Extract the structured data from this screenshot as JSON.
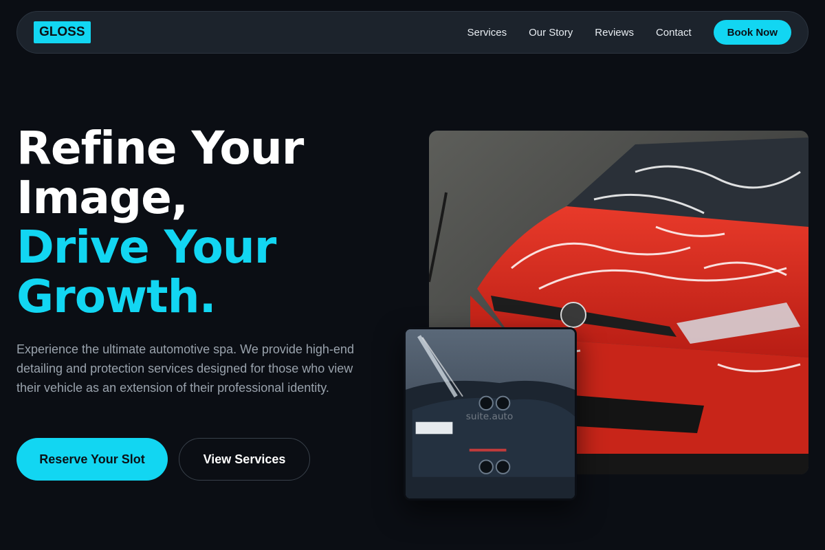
{
  "nav": {
    "logo": "GLOSS",
    "links": [
      "Services",
      "Our Story",
      "Reviews",
      "Contact"
    ],
    "cta": "Book Now"
  },
  "hero": {
    "headline_lines": [
      "Refine Your",
      "Image,"
    ],
    "accent_lines": [
      "Drive Your",
      "Growth."
    ],
    "description": "Experience the ultimate automotive spa. We provide high-end detailing and protection services designed for those who view their vehicle as an extension of their professional identity.",
    "primary_cta": "Reserve Your Slot",
    "secondary_cta": "View Services"
  },
  "images": {
    "main": "red-car-foam-wash-photo",
    "secondary": "dark-car-pressure-wash-photo",
    "secondary_watermark": "suite.auto"
  },
  "colors": {
    "accent": "#12d6f2",
    "background": "#0b0e14",
    "nav_background": "#1c232c",
    "body_text": "#9aa3ad"
  }
}
